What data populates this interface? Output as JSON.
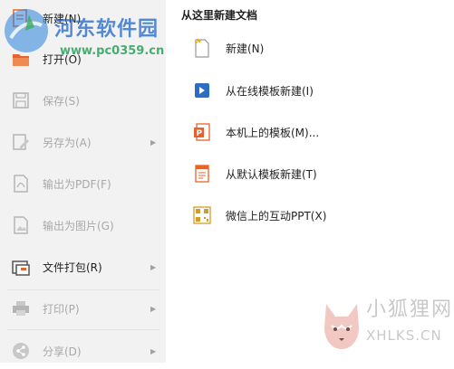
{
  "menu": {
    "items": [
      {
        "label": "新建(N)",
        "enabled": true,
        "icon": "new-icon"
      },
      {
        "label": "打开(O)",
        "enabled": true,
        "icon": "open-folder-icon"
      },
      {
        "label": "保存(S)",
        "enabled": false,
        "icon": "save-icon"
      },
      {
        "label": "另存为(A)",
        "enabled": false,
        "icon": "save-as-icon",
        "submenu": true
      },
      {
        "label": "输出为PDF(F)",
        "enabled": false,
        "icon": "pdf-export-icon"
      },
      {
        "label": "输出为图片(G)",
        "enabled": false,
        "icon": "image-export-icon"
      },
      {
        "label": "文件打包(R)",
        "enabled": true,
        "icon": "package-icon",
        "submenu": true
      },
      {
        "label": "打印(P)",
        "enabled": false,
        "icon": "printer-icon",
        "submenu": true
      },
      {
        "label": "分享(D)",
        "enabled": false,
        "icon": "share-icon",
        "submenu": true
      }
    ]
  },
  "panel": {
    "title": "从这里新建文档",
    "items": [
      {
        "label": "新建(N)",
        "icon": "blank-doc-icon"
      },
      {
        "label": "从在线模板新建(I)",
        "icon": "online-template-icon"
      },
      {
        "label": "本机上的模板(M)...",
        "icon": "local-template-icon"
      },
      {
        "label": "从默认模板新建(T)",
        "icon": "default-template-icon"
      },
      {
        "label": "微信上的互动PPT(X)",
        "icon": "wechat-qr-icon"
      }
    ]
  },
  "watermarks": {
    "top_title": "河东软件园",
    "top_url": "www.pc0359.cn",
    "bottom_title": "小狐狸网",
    "bottom_url": "XHLKS.CN"
  },
  "colors": {
    "menu_bg": "#f2f2f2",
    "accent_orange": "#e8632b",
    "accent_blue": "#2b6cc4",
    "disabled_text": "#a8a8a8"
  }
}
